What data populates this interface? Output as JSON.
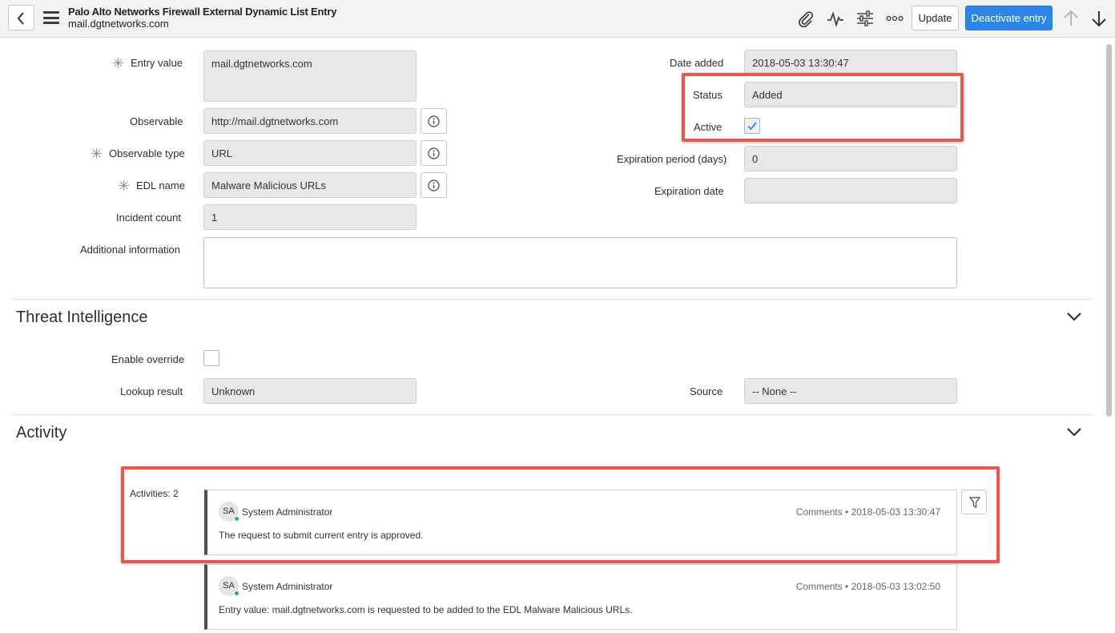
{
  "header": {
    "title": "Palo Alto Networks Firewall External Dynamic List Entry",
    "subtitle": "mail.dgtnetworks.com",
    "update_label": "Update",
    "deactivate_label": "Deactivate entry",
    "icons": [
      "back-icon",
      "menu-icon",
      "paperclip-icon",
      "activity-icon",
      "sliders-icon",
      "more-icon",
      "arrow-up-icon",
      "arrow-down-icon"
    ]
  },
  "form": {
    "entry_value": {
      "label": "Entry value",
      "value": "mail.dgtnetworks.com"
    },
    "observable": {
      "label": "Observable",
      "value": "http://mail.dgtnetworks.com"
    },
    "observable_type": {
      "label": "Observable type",
      "value": "URL"
    },
    "edl_name": {
      "label": "EDL name",
      "value": "Malware Malicious URLs"
    },
    "incident_count": {
      "label": "Incident count",
      "value": "1"
    },
    "additional_information": {
      "label": "Additional information",
      "value": ""
    },
    "date_added": {
      "label": "Date added",
      "value": "2018-05-03 13:30:47"
    },
    "status": {
      "label": "Status",
      "value": "Added"
    },
    "active": {
      "label": "Active",
      "checked": true
    },
    "expiration_period": {
      "label": "Expiration period (days)",
      "value": "0"
    },
    "expiration_date": {
      "label": "Expiration date",
      "value": ""
    }
  },
  "threat_intelligence": {
    "title": "Threat Intelligence",
    "enable_override": {
      "label": "Enable override",
      "checked": false
    },
    "lookup_result": {
      "label": "Lookup result",
      "value": "Unknown"
    },
    "source": {
      "label": "Source",
      "value": "-- None --"
    }
  },
  "activity": {
    "title": "Activity",
    "count_label": "Activities: 2",
    "entries": [
      {
        "initials": "SA",
        "user": "System Administrator",
        "meta": "Comments  •  2018-05-03 13:30:47",
        "text": "The request to submit current entry is approved."
      },
      {
        "initials": "SA",
        "user": "System Administrator",
        "meta": "Comments  •  2018-05-03 13:02:50",
        "text": "Entry value: mail.dgtnetworks.com is requested to be added to the EDL Malware Malicious URLs."
      }
    ]
  },
  "colors": {
    "primary": "#2b86e8",
    "highlight": "#e8574a",
    "presence": "#2fb34a"
  }
}
